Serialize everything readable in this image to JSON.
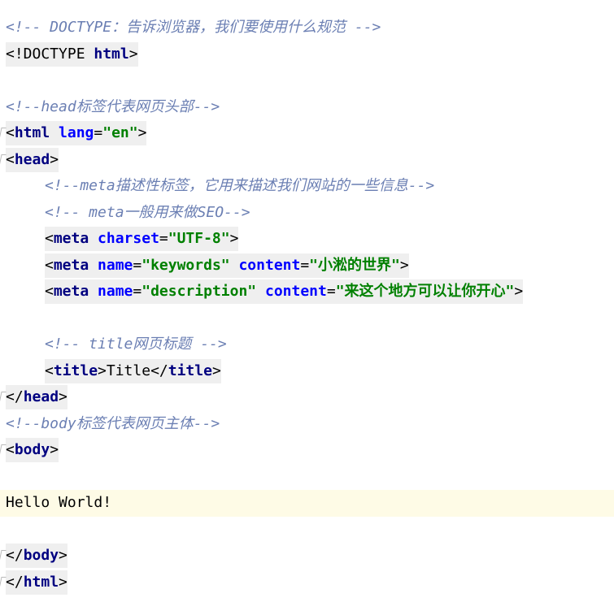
{
  "editor": {
    "language": "html",
    "current_line": 19,
    "lines": [
      {
        "kind": "comment",
        "text": "<!-- DOCTYPE：告诉浏览器，我们要使用什么规范 -->"
      },
      {
        "kind": "doctype",
        "open": "<!DOCTYPE ",
        "keyword": "html",
        "close": ">"
      },
      {
        "kind": "blank"
      },
      {
        "kind": "comment",
        "text": "<!--head标签代表网页头部-->"
      },
      {
        "kind": "tag",
        "tag": "html",
        "attrs": [
          {
            "name": "lang",
            "value": "\"en\""
          }
        ],
        "fold": true
      },
      {
        "kind": "tag",
        "tag": "head",
        "attrs": [],
        "fold": true
      },
      {
        "kind": "comment",
        "indent": true,
        "text": "<!--meta描述性标签，它用来描述我们网站的一些信息-->"
      },
      {
        "kind": "comment",
        "indent": true,
        "text": "<!-- meta一般用来做SEO-->"
      },
      {
        "kind": "tag",
        "indent": true,
        "tag": "meta",
        "attrs": [
          {
            "name": "charset",
            "value": "\"UTF-8\""
          }
        ]
      },
      {
        "kind": "tag",
        "indent": true,
        "tag": "meta",
        "attrs": [
          {
            "name": "name",
            "value": "\"keywords\""
          },
          {
            "name": "content",
            "value": "\"小淞的世界\""
          }
        ]
      },
      {
        "kind": "tag",
        "indent": true,
        "tag": "meta",
        "attrs": [
          {
            "name": "name",
            "value": "\"description\""
          },
          {
            "name": "content",
            "value": "\"来这个地方可以让你开心\""
          }
        ]
      },
      {
        "kind": "blank"
      },
      {
        "kind": "comment",
        "indent": true,
        "text": "<!-- title网页标题 -->"
      },
      {
        "kind": "element",
        "indent": true,
        "tag": "title",
        "text": "Title"
      },
      {
        "kind": "closetag",
        "tag": "head",
        "fold": true
      },
      {
        "kind": "comment",
        "text": "<!--body标签代表网页主体-->"
      },
      {
        "kind": "tag",
        "tag": "body",
        "attrs": [],
        "fold": true
      },
      {
        "kind": "blank"
      },
      {
        "kind": "text",
        "text": "Hello World!",
        "current": true
      },
      {
        "kind": "blank"
      },
      {
        "kind": "closetag",
        "tag": "body",
        "fold": true
      },
      {
        "kind": "closetag",
        "tag": "html",
        "fold": true
      }
    ]
  }
}
